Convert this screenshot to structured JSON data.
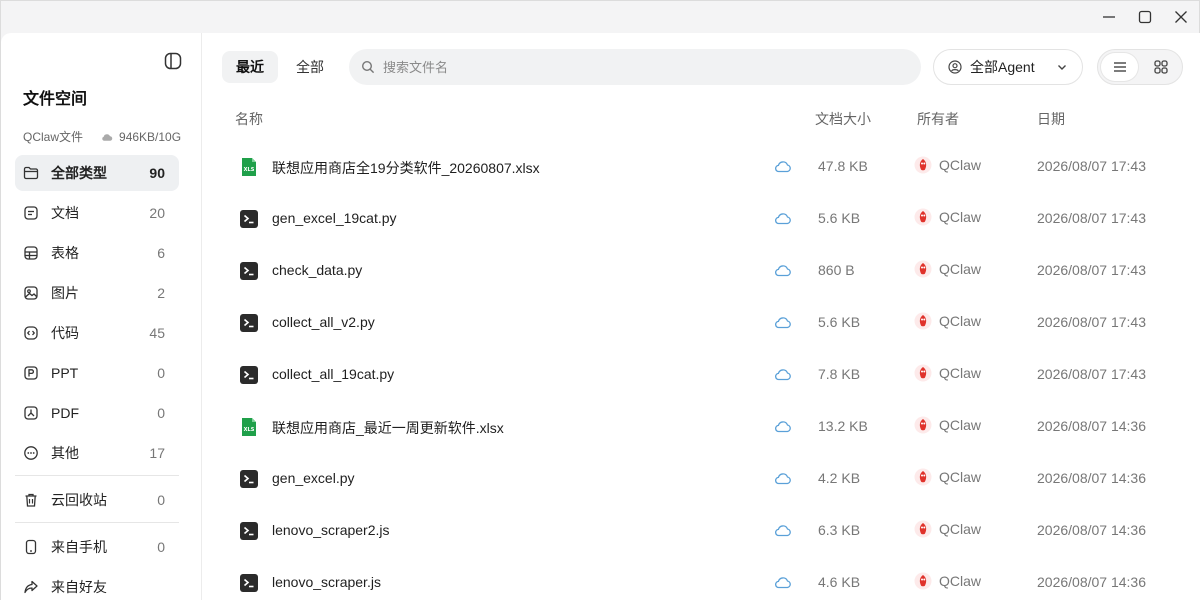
{
  "window": {
    "controls": [
      "minimize",
      "maximize",
      "close"
    ]
  },
  "sidebar": {
    "title": "文件空间",
    "storage_name": "QClaw文件",
    "storage_usage": "946KB/10G",
    "items": [
      {
        "label": "全部类型",
        "count": "90",
        "icon": "folder-icon"
      },
      {
        "label": "文档",
        "count": "20",
        "icon": "document-icon"
      },
      {
        "label": "表格",
        "count": "6",
        "icon": "table-icon"
      },
      {
        "label": "图片",
        "count": "2",
        "icon": "image-icon"
      },
      {
        "label": "代码",
        "count": "45",
        "icon": "code-icon"
      },
      {
        "label": "PPT",
        "count": "0",
        "icon": "ppt-icon"
      },
      {
        "label": "PDF",
        "count": "0",
        "icon": "pdf-icon"
      },
      {
        "label": "其他",
        "count": "17",
        "icon": "more-icon"
      },
      {
        "label": "云回收站",
        "count": "0",
        "icon": "trash-icon"
      },
      {
        "label": "来自手机",
        "count": "0",
        "icon": "phone-icon"
      },
      {
        "label": "来自好友",
        "count": "",
        "icon": "share-icon"
      }
    ]
  },
  "toolbar": {
    "tabs": [
      {
        "label": "最近"
      },
      {
        "label": "全部"
      }
    ],
    "search_placeholder": "搜索文件名",
    "agent_filter": "全部Agent"
  },
  "table": {
    "headers": {
      "name": "名称",
      "size": "文档大小",
      "owner": "所有者",
      "date": "日期"
    },
    "rows": [
      {
        "name": "联想应用商店全19分类软件_20260807.xlsx",
        "type": "xlsx",
        "size": "47.8 KB",
        "owner": "QClaw",
        "date": "2026/08/07 17:43"
      },
      {
        "name": "gen_excel_19cat.py",
        "type": "code",
        "size": "5.6 KB",
        "owner": "QClaw",
        "date": "2026/08/07 17:43"
      },
      {
        "name": "check_data.py",
        "type": "code",
        "size": "860 B",
        "owner": "QClaw",
        "date": "2026/08/07 17:43"
      },
      {
        "name": "collect_all_v2.py",
        "type": "code",
        "size": "5.6 KB",
        "owner": "QClaw",
        "date": "2026/08/07 17:43"
      },
      {
        "name": "collect_all_19cat.py",
        "type": "code",
        "size": "7.8 KB",
        "owner": "QClaw",
        "date": "2026/08/07 17:43"
      },
      {
        "name": "联想应用商店_最近一周更新软件.xlsx",
        "type": "xlsx",
        "size": "13.2 KB",
        "owner": "QClaw",
        "date": "2026/08/07 14:36"
      },
      {
        "name": "gen_excel.py",
        "type": "code",
        "size": "4.2 KB",
        "owner": "QClaw",
        "date": "2026/08/07 14:36"
      },
      {
        "name": "lenovo_scraper2.js",
        "type": "code",
        "size": "6.3 KB",
        "owner": "QClaw",
        "date": "2026/08/07 14:36"
      },
      {
        "name": "lenovo_scraper.js",
        "type": "code",
        "size": "4.6 KB",
        "owner": "QClaw",
        "date": "2026/08/07 14:36"
      }
    ]
  },
  "colors": {
    "xlsx_green": "#1fa04a",
    "code_dark": "#2b2b2b",
    "cloud_blue": "#5aa0d8",
    "logo_red": "#e0322b",
    "active_bg": "#eef0f2"
  },
  "xlsx_badge": "XLS"
}
